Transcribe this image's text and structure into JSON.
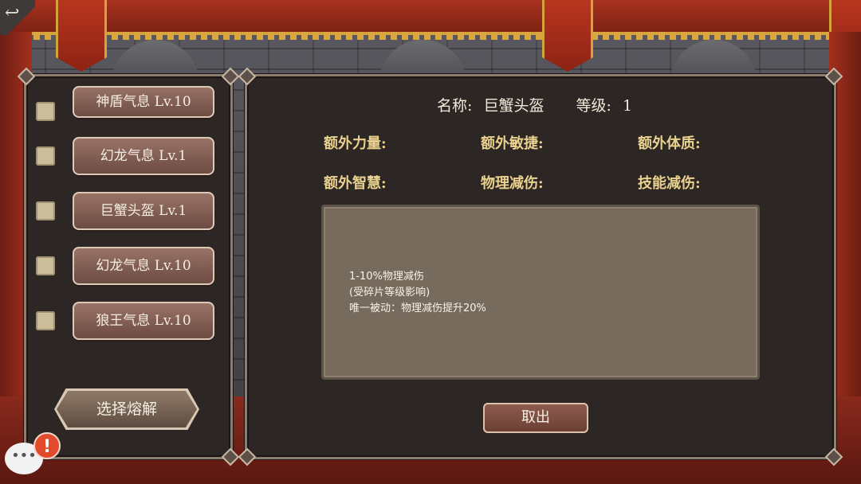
{
  "back_button": {
    "icon": "back-arrow-icon",
    "glyph": "↩"
  },
  "item_list": [
    {
      "label": "神盾气息 Lv.10",
      "checked": false
    },
    {
      "label": "幻龙气息 Lv.1",
      "checked": false
    },
    {
      "label": "巨蟹头盔 Lv.1",
      "checked": false
    },
    {
      "label": "幻龙气息 Lv.10",
      "checked": false
    },
    {
      "label": "狼王气息 Lv.10",
      "checked": false
    }
  ],
  "fuse_button": {
    "label": "选择熔解"
  },
  "detail": {
    "name_label": "名称:",
    "name_value": "巨蟹头盔",
    "level_label": "等级:",
    "level_value": "1",
    "stats": {
      "str": "额外力量:",
      "agi": "额外敏捷:",
      "con": "额外体质:",
      "wis": "额外智慧:",
      "phys_reduce": "物理减伤:",
      "skill_reduce": "技能减伤:"
    },
    "description": "1-10%物理减伤\n(受碎片等级影响)\n唯一被动：物理减伤提升20%",
    "cancel_label": "取出"
  },
  "chat": {
    "icon": "chat-bubble-icon",
    "glyph": "•••"
  },
  "alert": {
    "icon": "alert-icon",
    "glyph": "!"
  }
}
